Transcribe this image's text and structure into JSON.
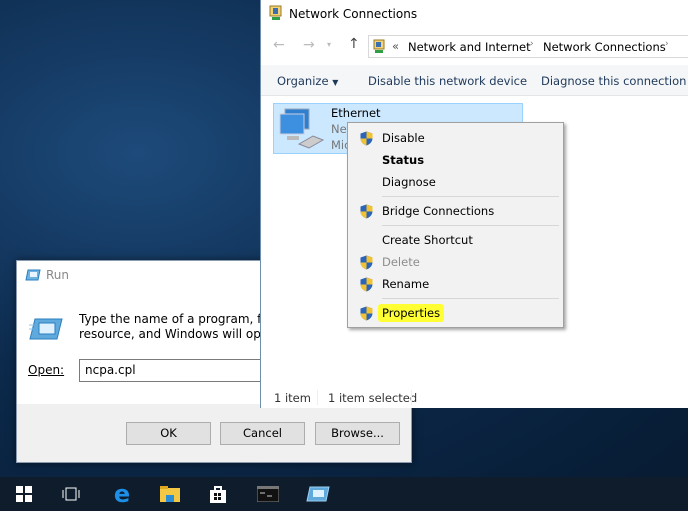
{
  "network_window": {
    "title": "Network Connections",
    "address": {
      "prefix": "«",
      "crumbs": [
        "Network and Internet",
        "Network Connections"
      ]
    },
    "toolbar": {
      "organize": "Organize",
      "disable": "Disable this network device",
      "diagnose": "Diagnose this connection"
    },
    "item": {
      "name": "Ethernet",
      "line2": "Netw",
      "line3": "Micr"
    },
    "status": {
      "count": "1 item",
      "selected": "1 item selected"
    }
  },
  "context_menu": {
    "items": [
      {
        "label": "Disable",
        "shield": true
      },
      {
        "label": "Status",
        "bold": true
      },
      {
        "label": "Diagnose"
      },
      {
        "label": "Bridge Connections",
        "shield": true
      },
      {
        "label": "Create Shortcut"
      },
      {
        "label": "Delete",
        "shield": true,
        "disabled": true
      },
      {
        "label": "Rename",
        "shield": true
      },
      {
        "label": "Properties",
        "shield": true,
        "highlighted": true
      }
    ],
    "highlight_color": "#ffff33"
  },
  "run_dialog": {
    "title": "Run",
    "description_line1": "Type the name of a program, folde",
    "description_line2": "resource, and Windows will open i",
    "open_label": "Open:",
    "open_value": "ncpa.cpl",
    "ok": "OK",
    "cancel": "Cancel",
    "browse": "Browse..."
  },
  "taskbar": {
    "icons": [
      "windows-start-icon",
      "task-view-icon",
      "edge-icon",
      "file-explorer-icon",
      "store-icon",
      "command-prompt-icon",
      "run-icon"
    ]
  }
}
